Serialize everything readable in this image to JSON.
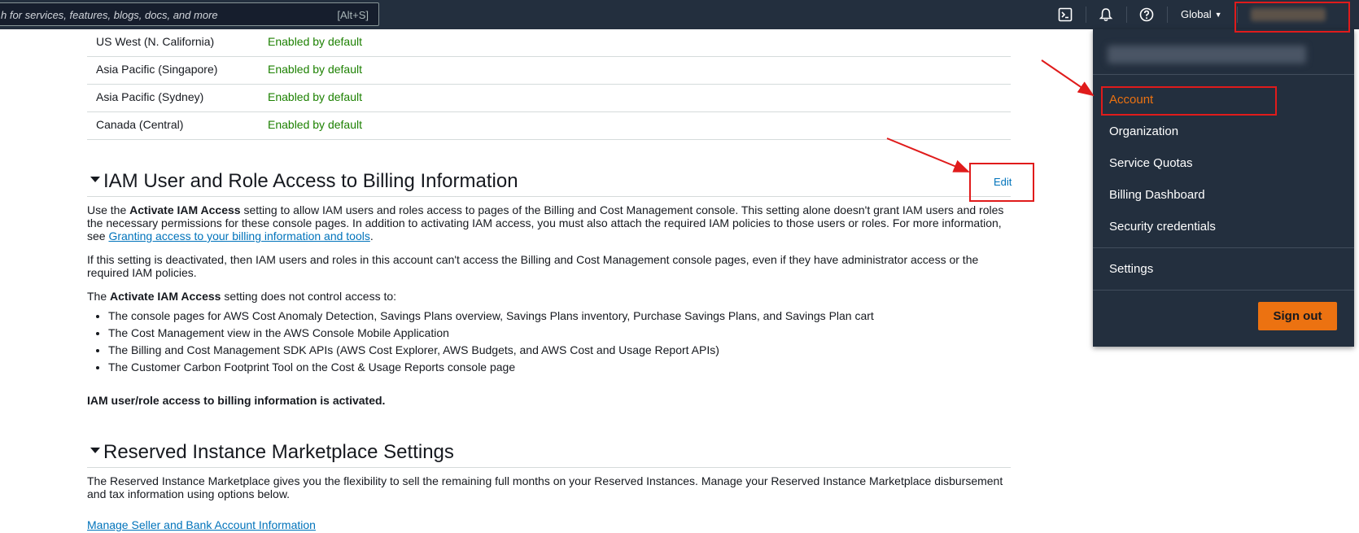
{
  "topnav": {
    "search_placeholder": "h for services, features, blogs, docs, and more",
    "search_shortcut": "[Alt+S]",
    "region": "Global",
    "icons": [
      "cloudshell-icon",
      "bell-icon",
      "help-icon"
    ]
  },
  "regions": [
    {
      "name": "US West (N. California)",
      "status": "Enabled by default"
    },
    {
      "name": "Asia Pacific (Singapore)",
      "status": "Enabled by default"
    },
    {
      "name": "Asia Pacific (Sydney)",
      "status": "Enabled by default"
    },
    {
      "name": "Canada (Central)",
      "status": "Enabled by default"
    }
  ],
  "iam_section": {
    "title": "IAM User and Role Access to Billing Information",
    "edit_label": "Edit",
    "p1_pre": "Use the ",
    "p1_bold": "Activate IAM Access",
    "p1_mid": " setting to allow IAM users and roles access to pages of the Billing and Cost Management console. This setting alone doesn't grant IAM users and roles the necessary permissions for these console pages. In addition to activating IAM access, you must also attach the required IAM policies to those users or roles. For more information, see ",
    "p1_link": "Granting access to your billing information and tools",
    "p1_end": ".",
    "p2": "If this setting is deactivated, then IAM users and roles in this account can't access the Billing and Cost Management console pages, even if they have administrator access or the required IAM policies.",
    "p3_pre": "The ",
    "p3_bold": "Activate IAM Access",
    "p3_end": " setting does not control access to:",
    "bullets": [
      "The console pages for AWS Cost Anomaly Detection, Savings Plans overview, Savings Plans inventory, Purchase Savings Plans, and Savings Plan cart",
      "The Cost Management view in the AWS Console Mobile Application",
      "The Billing and Cost Management SDK APIs (AWS Cost Explorer, AWS Budgets, and AWS Cost and Usage Report APIs)",
      "The Customer Carbon Footprint Tool on the Cost & Usage Reports console page"
    ],
    "status": "IAM user/role access to billing information is activated."
  },
  "ri_section": {
    "title": "Reserved Instance Marketplace Settings",
    "desc": "The Reserved Instance Marketplace gives you the flexibility to sell the remaining full months on your Reserved Instances. Manage your Reserved Instance Marketplace disbursement and tax information using options below.",
    "link": "Manage Seller and Bank Account Information"
  },
  "account_menu": {
    "items": [
      "Account",
      "Organization",
      "Service Quotas",
      "Billing Dashboard",
      "Security credentials"
    ],
    "settings": "Settings",
    "signout": "Sign out"
  },
  "colors": {
    "nav_bg": "#232f3e",
    "accent": "#ec7211",
    "link": "#0073bb",
    "success": "#1d8102",
    "annotation": "#e01b1b"
  }
}
